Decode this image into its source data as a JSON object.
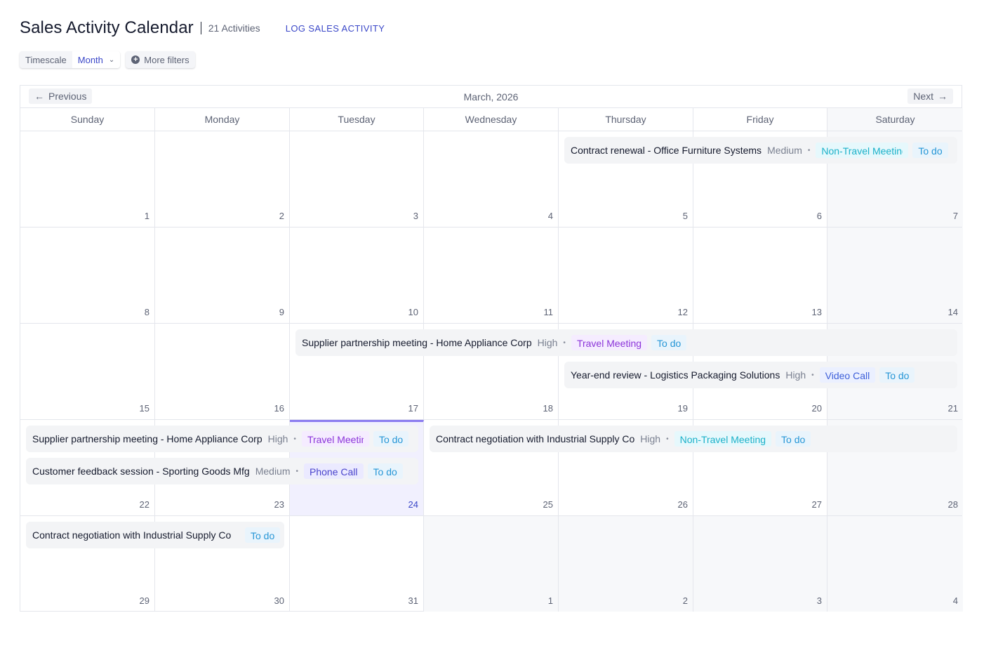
{
  "header": {
    "title": "Sales Activity Calendar",
    "count": "21 Activities",
    "log_link": "LOG SALES ACTIVITY"
  },
  "filters": {
    "timescale_label": "Timescale",
    "timescale_value": "Month",
    "more_filters": "More filters"
  },
  "calendar": {
    "month_title": "March, 2026",
    "prev_label": "Previous",
    "next_label": "Next",
    "weekdays": [
      "Sunday",
      "Monday",
      "Tuesday",
      "Wednesday",
      "Thursday",
      "Friday",
      "Saturday"
    ],
    "today": "24",
    "weeks": [
      [
        "1",
        "2",
        "3",
        "4",
        "5",
        "6",
        "7"
      ],
      [
        "8",
        "9",
        "10",
        "11",
        "12",
        "13",
        "14"
      ],
      [
        "15",
        "16",
        "17",
        "18",
        "19",
        "20",
        "21"
      ],
      [
        "22",
        "23",
        "24",
        "25",
        "26",
        "27",
        "28"
      ],
      [
        "29",
        "30",
        "31",
        "1",
        "2",
        "3",
        "4"
      ]
    ]
  },
  "events": [
    {
      "title": "Contract renewal - Office Furniture Systems",
      "priority": "Medium",
      "type": "Non-Travel Meeting",
      "status": "To do"
    },
    {
      "title": "Supplier partnership meeting - Home Appliance Corp",
      "priority": "High",
      "type": "Travel Meeting",
      "status": "To do"
    },
    {
      "title": "Year-end review - Logistics Packaging Solutions",
      "priority": "High",
      "type": "Video Call",
      "status": "To do"
    },
    {
      "title": "Supplier partnership meeting - Home Appliance Corp",
      "priority": "High",
      "type": "Travel Meeting",
      "status": "To do"
    },
    {
      "title": "Customer feedback session - Sporting Goods Mfg",
      "priority": "Medium",
      "type": "Phone Call",
      "status": "To do"
    },
    {
      "title": "Contract negotiation with Industrial Supply Co",
      "priority": "High",
      "type": "Non-Travel Meeting",
      "status": "To do"
    },
    {
      "title": "Contract negotiation with Industrial Supply Co",
      "priority": "",
      "type": "",
      "status": "To do"
    }
  ]
}
